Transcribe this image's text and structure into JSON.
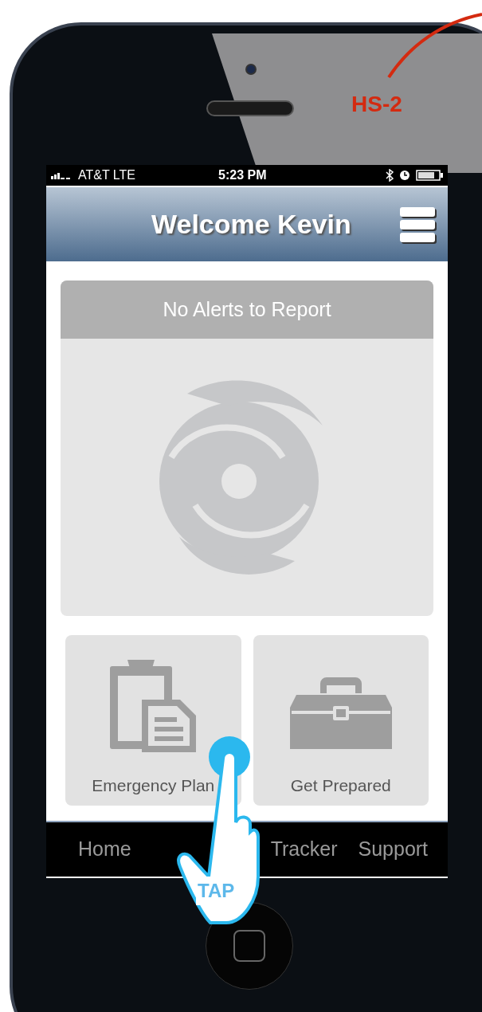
{
  "annotation": {
    "label": "HS-2"
  },
  "status_bar": {
    "carrier": "AT&T LTE",
    "time": "5:23 PM"
  },
  "header": {
    "title": "Welcome Kevin"
  },
  "alert_card": {
    "message": "No Alerts to Report"
  },
  "tiles": [
    {
      "kind": "plan",
      "label": "Emergency Plan"
    },
    {
      "kind": "kit",
      "label": "Get Prepared"
    }
  ],
  "tab_bar": [
    {
      "label": "Home"
    },
    {
      "label": "Tracker"
    },
    {
      "label": "Support"
    }
  ],
  "tap_hint": {
    "label": "TAP"
  }
}
